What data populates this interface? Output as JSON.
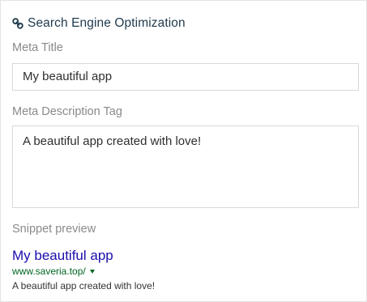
{
  "section": {
    "title": "Search Engine Optimization",
    "icon": "link-icon"
  },
  "meta_title": {
    "label": "Meta Title",
    "value": "My beautiful app"
  },
  "meta_description": {
    "label": "Meta Description Tag",
    "value": "A beautiful app created with love!"
  },
  "snippet": {
    "label": "Snippet preview",
    "title": "My beautiful app",
    "url": "www.saveria.top/",
    "description": "A beautiful app created with love!",
    "title_color": "#1a0dab",
    "url_color": "#006621"
  }
}
